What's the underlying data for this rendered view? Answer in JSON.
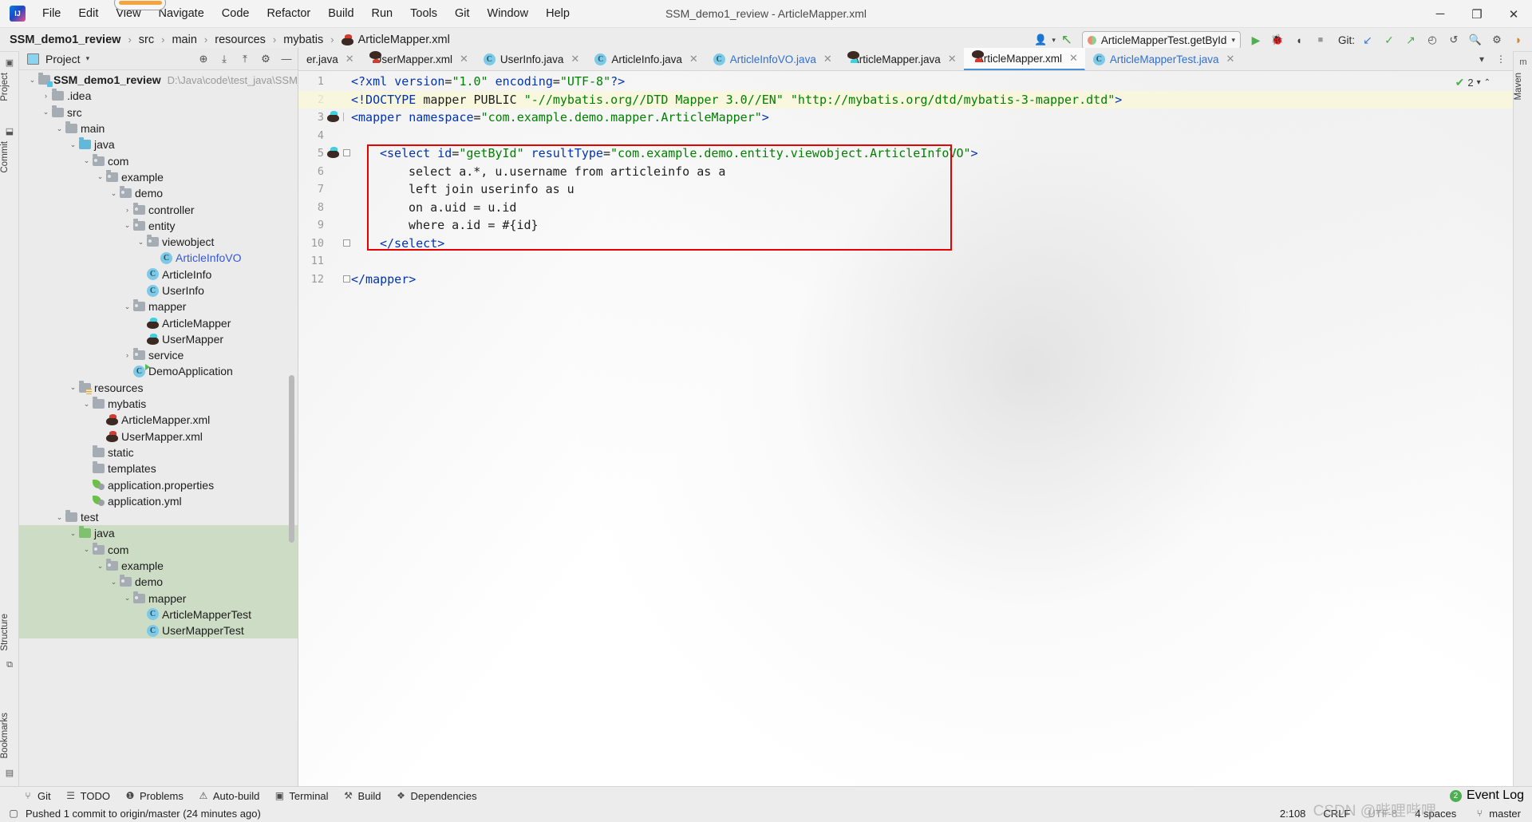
{
  "window": {
    "title": "SSM_demo1_review - ArticleMapper.xml",
    "minimize": "─",
    "maximize": "❐",
    "close": "✕"
  },
  "menu": [
    {
      "label": "File"
    },
    {
      "label": "Edit"
    },
    {
      "label": "View"
    },
    {
      "label": "Navigate"
    },
    {
      "label": "Code"
    },
    {
      "label": "Refactor"
    },
    {
      "label": "Build"
    },
    {
      "label": "Run"
    },
    {
      "label": "Tools"
    },
    {
      "label": "Git"
    },
    {
      "label": "Window"
    },
    {
      "label": "Help"
    }
  ],
  "breadcrumb": {
    "items": [
      "SSM_demo1_review",
      "src",
      "main",
      "resources",
      "mybatis",
      "ArticleMapper.xml"
    ],
    "separator": "›"
  },
  "toolbar": {
    "run_config": "ArticleMapperTest.getById",
    "git_label": "Git:",
    "icons": {
      "user": "👤",
      "back_arrow": "↖",
      "run": "▶",
      "debug": "🐞",
      "run_coverage": "◖",
      "stop": "■",
      "update": "↙",
      "commit": "✓",
      "push": "↗",
      "history": "◴",
      "rollback": "↺",
      "search": "🔍",
      "settings": "⚙"
    }
  },
  "rails": {
    "left": [
      {
        "label": "Project"
      },
      {
        "label": "Commit"
      },
      {
        "label": "Structure"
      },
      {
        "label": "Bookmarks"
      }
    ],
    "right": [
      {
        "label": "Maven"
      }
    ]
  },
  "project_panel": {
    "title": "Project",
    "caret": "▾",
    "buttons": [
      "locate-icon",
      "expand-all-icon",
      "collapse-all-icon",
      "gear-icon",
      "hide-icon"
    ],
    "tree": [
      {
        "indent": 0,
        "arrow": "⌄",
        "icon": "folder-module",
        "label": "SSM_demo1_review",
        "path": "D:\\Java\\code\\test_java\\SSM_de",
        "bold": true
      },
      {
        "indent": 1,
        "arrow": "›",
        "icon": "folder-plain",
        "label": ".idea"
      },
      {
        "indent": 1,
        "arrow": "⌄",
        "icon": "folder-plain",
        "label": "src"
      },
      {
        "indent": 2,
        "arrow": "⌄",
        "icon": "folder-plain",
        "label": "main"
      },
      {
        "indent": 3,
        "arrow": "⌄",
        "icon": "folder-source",
        "label": "java"
      },
      {
        "indent": 4,
        "arrow": "⌄",
        "icon": "folder-package",
        "label": "com"
      },
      {
        "indent": 5,
        "arrow": "⌄",
        "icon": "folder-package",
        "label": "example"
      },
      {
        "indent": 6,
        "arrow": "⌄",
        "icon": "folder-package",
        "label": "demo"
      },
      {
        "indent": 7,
        "arrow": "›",
        "icon": "folder-package",
        "label": "controller"
      },
      {
        "indent": 7,
        "arrow": "⌄",
        "icon": "folder-package",
        "label": "entity"
      },
      {
        "indent": 8,
        "arrow": "⌄",
        "icon": "folder-package",
        "label": "viewobject"
      },
      {
        "indent": 9,
        "arrow": "",
        "icon": "class-icon",
        "label": "ArticleInfoVO",
        "blue": true
      },
      {
        "indent": 8,
        "arrow": "",
        "icon": "class-icon",
        "label": "ArticleInfo"
      },
      {
        "indent": 8,
        "arrow": "",
        "icon": "class-icon",
        "label": "UserInfo"
      },
      {
        "indent": 7,
        "arrow": "⌄",
        "icon": "folder-package",
        "label": "mapper"
      },
      {
        "indent": 8,
        "arrow": "",
        "icon": "mybatis-java-icon",
        "label": "ArticleMapper"
      },
      {
        "indent": 8,
        "arrow": "",
        "icon": "mybatis-java-icon",
        "label": "UserMapper"
      },
      {
        "indent": 7,
        "arrow": "›",
        "icon": "folder-package",
        "label": "service"
      },
      {
        "indent": 7,
        "arrow": "",
        "icon": "class-run-icon",
        "label": "DemoApplication"
      },
      {
        "indent": 3,
        "arrow": "⌄",
        "icon": "folder-resources",
        "label": "resources"
      },
      {
        "indent": 4,
        "arrow": "⌄",
        "icon": "folder-plain",
        "label": "mybatis"
      },
      {
        "indent": 5,
        "arrow": "",
        "icon": "mybatis-xml-icon",
        "label": "ArticleMapper.xml"
      },
      {
        "indent": 5,
        "arrow": "",
        "icon": "mybatis-xml-icon",
        "label": "UserMapper.xml"
      },
      {
        "indent": 4,
        "arrow": "",
        "icon": "folder-plain",
        "label": "static"
      },
      {
        "indent": 4,
        "arrow": "",
        "icon": "folder-plain",
        "label": "templates"
      },
      {
        "indent": 4,
        "arrow": "",
        "icon": "leaf-icon",
        "label": "application.properties"
      },
      {
        "indent": 4,
        "arrow": "",
        "icon": "leaf-icon",
        "label": "application.yml"
      },
      {
        "indent": 2,
        "arrow": "⌄",
        "icon": "folder-plain",
        "label": "test"
      },
      {
        "indent": 3,
        "arrow": "⌄",
        "icon": "folder-test",
        "label": "java",
        "highlight": true
      },
      {
        "indent": 4,
        "arrow": "⌄",
        "icon": "folder-package",
        "label": "com",
        "highlight": true
      },
      {
        "indent": 5,
        "arrow": "⌄",
        "icon": "folder-package",
        "label": "example",
        "highlight": true
      },
      {
        "indent": 6,
        "arrow": "⌄",
        "icon": "folder-package",
        "label": "demo",
        "highlight": true
      },
      {
        "indent": 7,
        "arrow": "⌄",
        "icon": "folder-package",
        "label": "mapper",
        "highlight": true
      },
      {
        "indent": 8,
        "arrow": "",
        "icon": "class-icon",
        "label": "ArticleMapperTest",
        "highlight": true
      },
      {
        "indent": 8,
        "arrow": "",
        "icon": "class-icon",
        "label": "UserMapperTest",
        "highlight": true
      }
    ]
  },
  "editor": {
    "tabs": [
      {
        "label": "er.java",
        "icon": "class-icon",
        "active": false,
        "clipped": true
      },
      {
        "label": "UserMapper.xml",
        "icon": "mybatis-xml-icon",
        "active": false
      },
      {
        "label": "UserInfo.java",
        "icon": "class-icon",
        "active": false
      },
      {
        "label": "ArticleInfo.java",
        "icon": "class-icon",
        "active": false
      },
      {
        "label": "ArticleInfoVO.java",
        "icon": "class-icon",
        "active": false,
        "blue": true
      },
      {
        "label": "ArticleMapper.java",
        "icon": "mybatis-java-icon",
        "active": false
      },
      {
        "label": "ArticleMapper.xml",
        "icon": "mybatis-xml-icon",
        "active": true
      },
      {
        "label": "ArticleMapperTest.java",
        "icon": "class-icon",
        "active": false,
        "blue": true
      }
    ],
    "tab_close": "✕",
    "inspection_count": "2",
    "lines": [
      {
        "num": "1",
        "indent": 0,
        "gutter": "",
        "fold": "",
        "highlight": false,
        "tokens": [
          {
            "t": "<?xml ",
            "c": "tag"
          },
          {
            "t": "version",
            "c": "attr"
          },
          {
            "t": "=",
            "c": "punc"
          },
          {
            "t": "\"1.0\"",
            "c": "str"
          },
          {
            "t": " ",
            "c": "plain"
          },
          {
            "t": "encoding",
            "c": "attr"
          },
          {
            "t": "=",
            "c": "punc"
          },
          {
            "t": "\"UTF-8\"",
            "c": "str"
          },
          {
            "t": "?>",
            "c": "tag"
          }
        ]
      },
      {
        "num": "2",
        "indent": 0,
        "gutter": "",
        "fold": "",
        "highlight": true,
        "tokens": [
          {
            "t": "<!DOCTYPE ",
            "c": "tag"
          },
          {
            "t": "mapper PUBLIC ",
            "c": "plain"
          },
          {
            "t": "\"-//mybatis.org//DTD Mapper 3.0//EN\"",
            "c": "str"
          },
          {
            "t": " ",
            "c": "plain"
          },
          {
            "t": "\"http://mybatis.org/dtd/mybatis-3-mapper.dtd\"",
            "c": "str"
          },
          {
            "t": ">",
            "c": "tag"
          }
        ]
      },
      {
        "num": "3",
        "indent": 0,
        "gutter": "mybatis",
        "fold": "line",
        "highlight": false,
        "tokens": [
          {
            "t": "<mapper ",
            "c": "tag"
          },
          {
            "t": "namespace",
            "c": "attr"
          },
          {
            "t": "=",
            "c": "punc"
          },
          {
            "t": "\"com.example.demo.mapper.ArticleMapper\"",
            "c": "str"
          },
          {
            "t": ">",
            "c": "tag"
          }
        ]
      },
      {
        "num": "4",
        "indent": 0,
        "gutter": "",
        "fold": "",
        "highlight": false,
        "tokens": []
      },
      {
        "num": "5",
        "indent": 1,
        "gutter": "mybatis",
        "fold": "box",
        "highlight": false,
        "tokens": [
          {
            "t": "<select ",
            "c": "tag"
          },
          {
            "t": "id",
            "c": "attr"
          },
          {
            "t": "=",
            "c": "punc"
          },
          {
            "t": "\"getById\"",
            "c": "str"
          },
          {
            "t": " ",
            "c": "plain"
          },
          {
            "t": "resultType",
            "c": "attr"
          },
          {
            "t": "=",
            "c": "punc"
          },
          {
            "t": "\"com.example.demo.entity.viewobject.ArticleInfoVO\"",
            "c": "str"
          },
          {
            "t": ">",
            "c": "tag"
          }
        ]
      },
      {
        "num": "6",
        "indent": 2,
        "gutter": "",
        "fold": "",
        "highlight": false,
        "tokens": [
          {
            "t": "select a.*, u.username from articleinfo as a",
            "c": "plain"
          }
        ]
      },
      {
        "num": "7",
        "indent": 2,
        "gutter": "",
        "fold": "",
        "highlight": false,
        "tokens": [
          {
            "t": "left join userinfo as u",
            "c": "plain"
          }
        ]
      },
      {
        "num": "8",
        "indent": 2,
        "gutter": "",
        "fold": "",
        "highlight": false,
        "tokens": [
          {
            "t": "on a.uid = u.id",
            "c": "plain"
          }
        ]
      },
      {
        "num": "9",
        "indent": 2,
        "gutter": "",
        "fold": "",
        "highlight": false,
        "tokens": [
          {
            "t": "where a.id = #{id}",
            "c": "plain"
          }
        ]
      },
      {
        "num": "10",
        "indent": 1,
        "gutter": "",
        "fold": "box",
        "highlight": false,
        "tokens": [
          {
            "t": "</select>",
            "c": "tag"
          }
        ]
      },
      {
        "num": "11",
        "indent": 0,
        "gutter": "",
        "fold": "",
        "highlight": false,
        "tokens": []
      },
      {
        "num": "12",
        "indent": 0,
        "gutter": "",
        "fold": "boxend",
        "highlight": false,
        "tokens": [
          {
            "t": "</mapper>",
            "c": "tag"
          }
        ]
      }
    ]
  },
  "bottom_bar": {
    "items": [
      {
        "label": "Git",
        "icon": "git-branch-icon"
      },
      {
        "label": "TODO",
        "icon": "todo-list-icon"
      },
      {
        "label": "Problems",
        "icon": "problems-icon"
      },
      {
        "label": "Auto-build",
        "icon": "warning-icon"
      },
      {
        "label": "Terminal",
        "icon": "terminal-icon"
      },
      {
        "label": "Build",
        "icon": "hammer-icon"
      },
      {
        "label": "Dependencies",
        "icon": "layers-icon"
      }
    ],
    "event_log": "Event Log",
    "event_log_count": "2"
  },
  "status_bar": {
    "message": "Pushed 1 commit to origin/master (24 minutes ago)",
    "caret_position": "2:108",
    "line_separator": "CRLF",
    "encoding": "UTF-8",
    "indent": "4 spaces",
    "branch": "master",
    "watermark": "CSDN @哔哩哔哩"
  },
  "colors": {
    "accent_blue": "#3457d5",
    "string_green": "#008000",
    "tag_blue": "#0033b3",
    "red_box": "#e60000",
    "highlight_green": "#a8cd96"
  }
}
